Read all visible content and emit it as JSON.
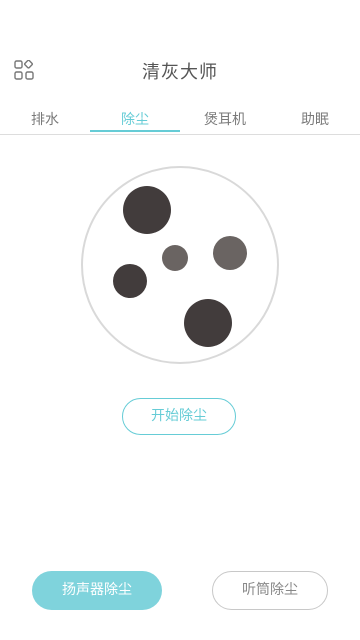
{
  "header": {
    "title": "清灰大师",
    "apps_icon": "apps-grid-icon"
  },
  "tabs": [
    {
      "label": "排水",
      "active": false
    },
    {
      "label": "除尘",
      "active": true
    },
    {
      "label": "煲耳机",
      "active": false
    },
    {
      "label": "助眠",
      "active": false
    }
  ],
  "main": {
    "start_button_label": "开始除尘"
  },
  "bottom": {
    "speaker_button_label": "扬声器除尘",
    "earpiece_button_label": "听筒除尘"
  },
  "colors": {
    "accent": "#66ccd6",
    "accent_fill": "#7fd3dc",
    "dust_dark": "#423c3c",
    "dust_light": "#6a6462"
  }
}
